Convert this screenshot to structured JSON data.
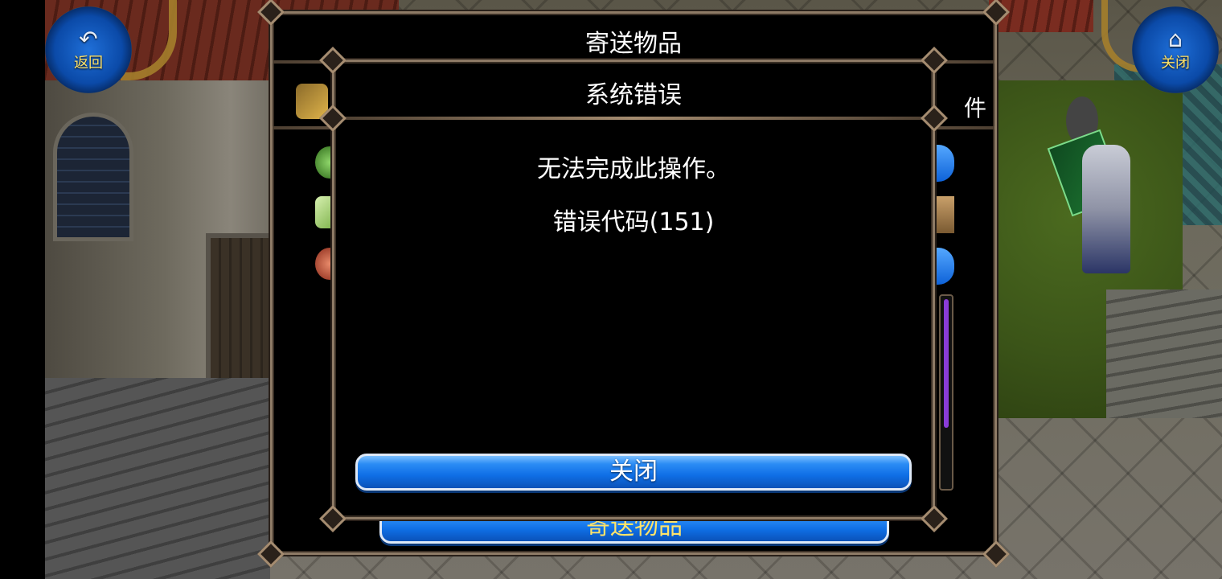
{
  "top_left_button": {
    "label": "返回",
    "icon": "back-arrow-icon"
  },
  "top_right_button": {
    "label": "关闭",
    "icon": "home-icon"
  },
  "outer_panel": {
    "title": "寄送物品",
    "tab_partial": "件",
    "send_button": "寄送物品"
  },
  "error_dialog": {
    "title": "系统错误",
    "message": "无法完成此操作。",
    "code": "错误代码(151)",
    "close_button": "关闭"
  },
  "colors": {
    "button_blue": "#0f6fe6",
    "frame_border": "#8e7b66",
    "gold_text": "#ffe36a"
  }
}
